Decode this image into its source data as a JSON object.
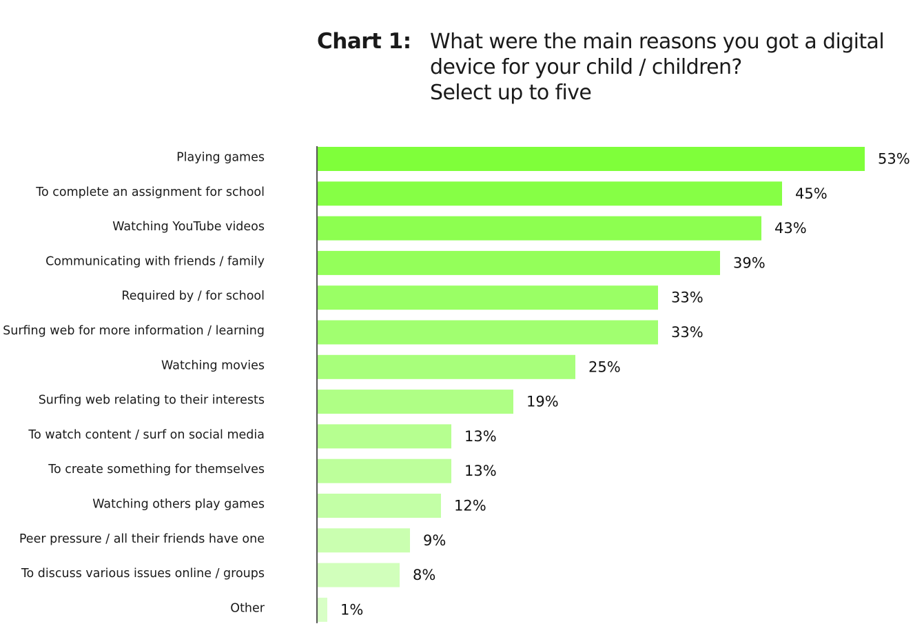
{
  "header": {
    "chart_number": "Chart 1:",
    "question": "What were the main reasons you got a digital device for your child / children?",
    "instruction": "Select up to five"
  },
  "colors": {
    "bar_start": "#7FFF3A",
    "bar_end": "#D8FFC6",
    "axis": "#555555",
    "text": "#1a1a1a"
  },
  "chart_data": {
    "type": "bar",
    "orientation": "horizontal",
    "title": "What were the main reasons you got a digital device for your child / children?",
    "subtitle": "Select up to five",
    "xlabel": "",
    "ylabel": "",
    "xlim": [
      0,
      53
    ],
    "grid": false,
    "legend": "none",
    "value_suffix": "%",
    "categories": [
      "Playing games",
      "To complete an assignment for school",
      "Watching YouTube videos",
      "Communicating with friends / family",
      "Required by / for school",
      "Surfing web for more information / learning",
      "Watching movies",
      "Surfing web relating to their interests",
      "To watch content / surf on social media",
      "To create something for themselves",
      "Watching others play games",
      "Peer pressure / all their friends have one",
      "To discuss various issues online / groups",
      "Other"
    ],
    "values": [
      53,
      45,
      43,
      39,
      33,
      33,
      25,
      19,
      13,
      13,
      12,
      9,
      8,
      1
    ],
    "labels": [
      "53%",
      "45%",
      "43%",
      "39%",
      "33%",
      "33%",
      "25%",
      "19%",
      "13%",
      "13%",
      "12%",
      "9%",
      "8%",
      "1%"
    ]
  }
}
